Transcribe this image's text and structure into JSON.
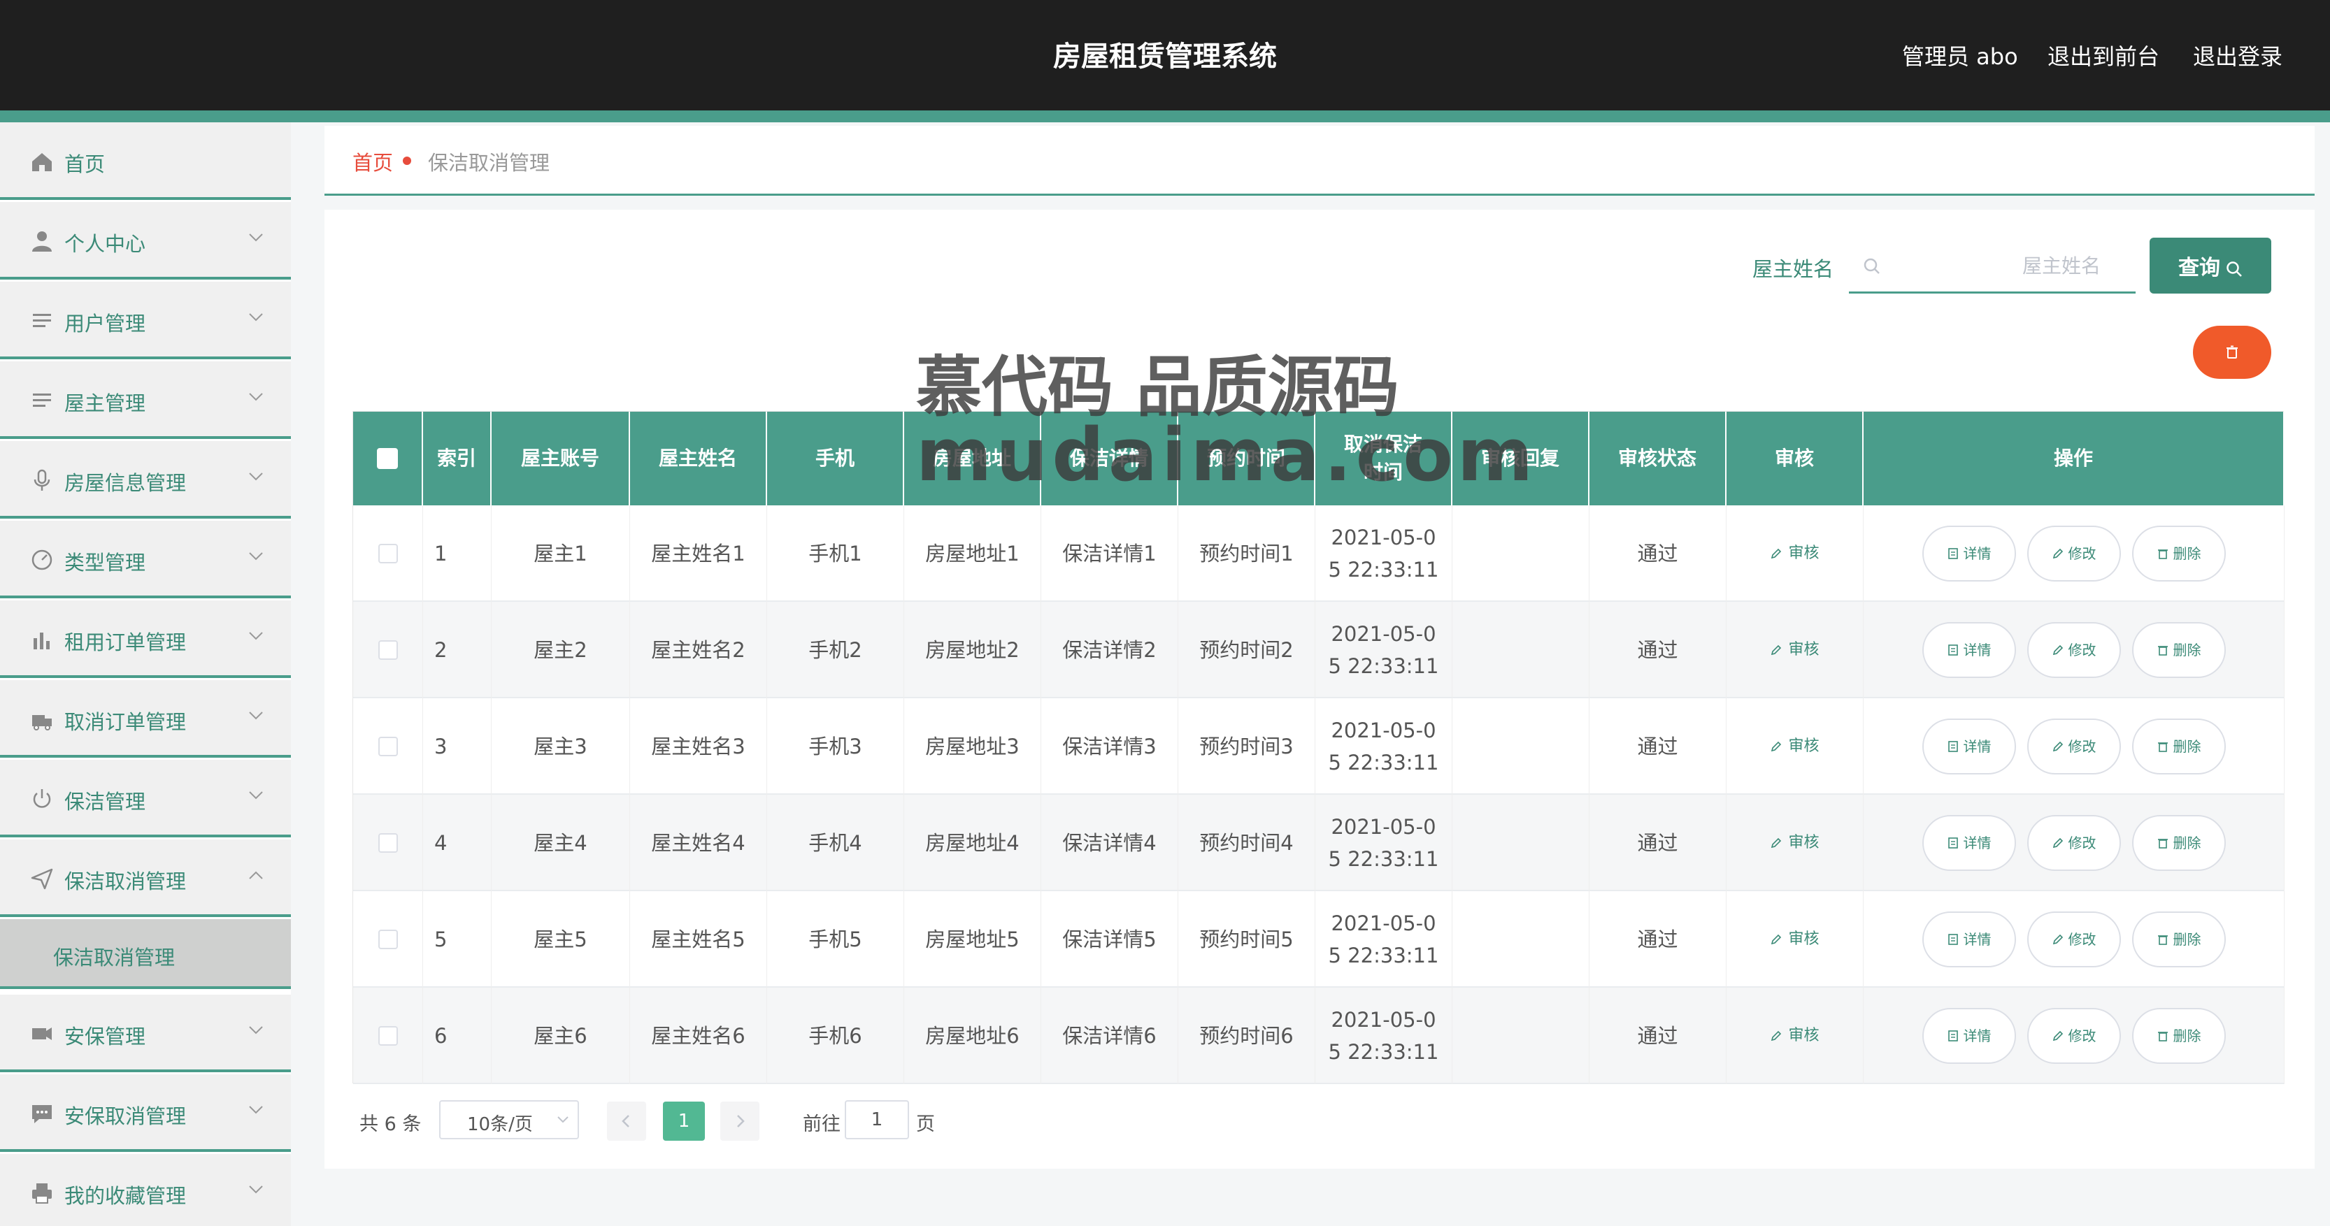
{
  "header": {
    "title": "房屋租赁管理系统",
    "admin": "管理员 abo",
    "exit_front": "退出到前台",
    "logout": "退出登录"
  },
  "sidebar": {
    "items": [
      {
        "label": "首页",
        "icon": "home-icon"
      },
      {
        "label": "个人中心",
        "icon": "user-icon"
      },
      {
        "label": "用户管理",
        "icon": "list-icon"
      },
      {
        "label": "屋主管理",
        "icon": "list-icon"
      },
      {
        "label": "房屋信息管理",
        "icon": "microphone-icon"
      },
      {
        "label": "类型管理",
        "icon": "dashboard-icon"
      },
      {
        "label": "租用订单管理",
        "icon": "chart-icon"
      },
      {
        "label": "取消订单管理",
        "icon": "truck-icon"
      },
      {
        "label": "保洁管理",
        "icon": "power-icon"
      },
      {
        "label": "保洁取消管理",
        "icon": "send-icon"
      },
      {
        "label": "安保管理",
        "icon": "camera-icon"
      },
      {
        "label": "安保取消管理",
        "icon": "chat-icon"
      },
      {
        "label": "我的收藏管理",
        "icon": "printer-icon"
      }
    ],
    "active_sub": "保洁取消管理"
  },
  "breadcrumb": {
    "home": "首页",
    "current": "保洁取消管理"
  },
  "search": {
    "label": "屋主姓名",
    "placeholder": "屋主姓名",
    "button": "查询"
  },
  "table": {
    "headers": [
      "索引",
      "屋主账号",
      "屋主姓名",
      "手机",
      "房屋地址",
      "保洁详情",
      "预约时间",
      "取消保洁时间",
      "审核回复",
      "审核状态",
      "审核",
      "操作"
    ],
    "rows": [
      {
        "index": "1",
        "account": "屋主1",
        "name": "屋主姓名1",
        "phone": "手机1",
        "address": "房屋地址1",
        "detail": "保洁详情1",
        "time": "预约时间1",
        "cancel_time": "2021-05-05 22:33:11",
        "reply": "",
        "status": "通过"
      },
      {
        "index": "2",
        "account": "屋主2",
        "name": "屋主姓名2",
        "phone": "手机2",
        "address": "房屋地址2",
        "detail": "保洁详情2",
        "time": "预约时间2",
        "cancel_time": "2021-05-05 22:33:11",
        "reply": "",
        "status": "通过"
      },
      {
        "index": "3",
        "account": "屋主3",
        "name": "屋主姓名3",
        "phone": "手机3",
        "address": "房屋地址3",
        "detail": "保洁详情3",
        "time": "预约时间3",
        "cancel_time": "2021-05-05 22:33:11",
        "reply": "",
        "status": "通过"
      },
      {
        "index": "4",
        "account": "屋主4",
        "name": "屋主姓名4",
        "phone": "手机4",
        "address": "房屋地址4",
        "detail": "保洁详情4",
        "time": "预约时间4",
        "cancel_time": "2021-05-05 22:33:11",
        "reply": "",
        "status": "通过"
      },
      {
        "index": "5",
        "account": "屋主5",
        "name": "屋主姓名5",
        "phone": "手机5",
        "address": "房屋地址5",
        "detail": "保洁详情5",
        "time": "预约时间5",
        "cancel_time": "2021-05-05 22:33:11",
        "reply": "",
        "status": "通过"
      },
      {
        "index": "6",
        "account": "屋主6",
        "name": "屋主姓名6",
        "phone": "手机6",
        "address": "房屋地址6",
        "detail": "保洁详情6",
        "time": "预约时间6",
        "cancel_time": "2021-05-05 22:33:11",
        "reply": "",
        "status": "通过"
      }
    ],
    "audit_label": "审核",
    "detail_label": "详情",
    "edit_label": "修改",
    "delete_label": "删除"
  },
  "pagination": {
    "total": "共 6 条",
    "page_size": "10条/页",
    "current": "1",
    "goto": "前往",
    "goto_value": "1",
    "page_unit": "页"
  },
  "watermark": {
    "line1": "慕代码 品质源码",
    "line2": "mudaima.com"
  },
  "colors": {
    "accent": "#4a9d8b",
    "topbar": "#1f1f1f",
    "danger": "#f05a2a",
    "breadcrumb_home": "#e74c3c"
  }
}
